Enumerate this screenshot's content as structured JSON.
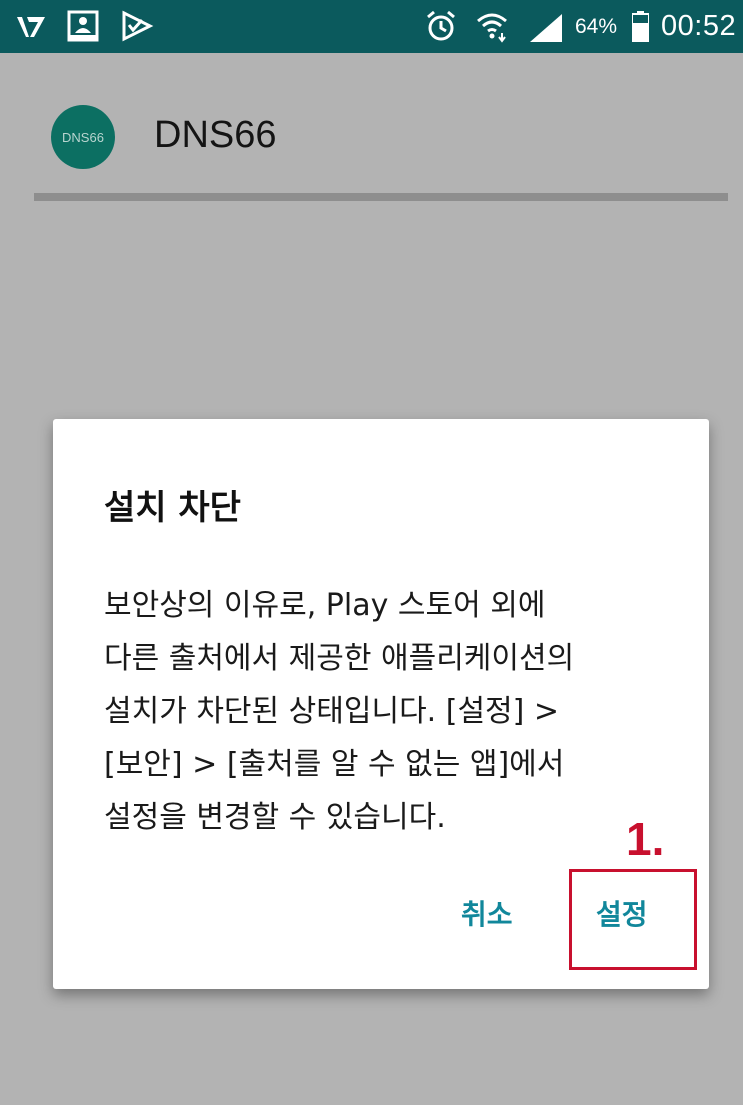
{
  "status_bar": {
    "left_icons": [
      "v-icon",
      "download-icon",
      "check-flag-icon"
    ],
    "battery_percent": "64%",
    "time": "00:52",
    "background_color": "#0b5a5d"
  },
  "app": {
    "icon_text": "DNS66",
    "title": "DNS66",
    "icon_color": "#0c6f62"
  },
  "dialog": {
    "title": "설치 차단",
    "message_lines": [
      "보안상의 이유로, Play 스토어 외에",
      "다른 출처에서 제공한 애플리케이션의",
      "설치가 차단된 상태입니다. [설정] >",
      "[보안] > [출처를 알 수 없는 앱]에서",
      "설정을 변경할 수 있습니다."
    ],
    "cancel_label": "취소",
    "settings_label": "설정",
    "button_color": "#11879b"
  },
  "annotation": {
    "label": "1.",
    "color": "#c8102e"
  }
}
